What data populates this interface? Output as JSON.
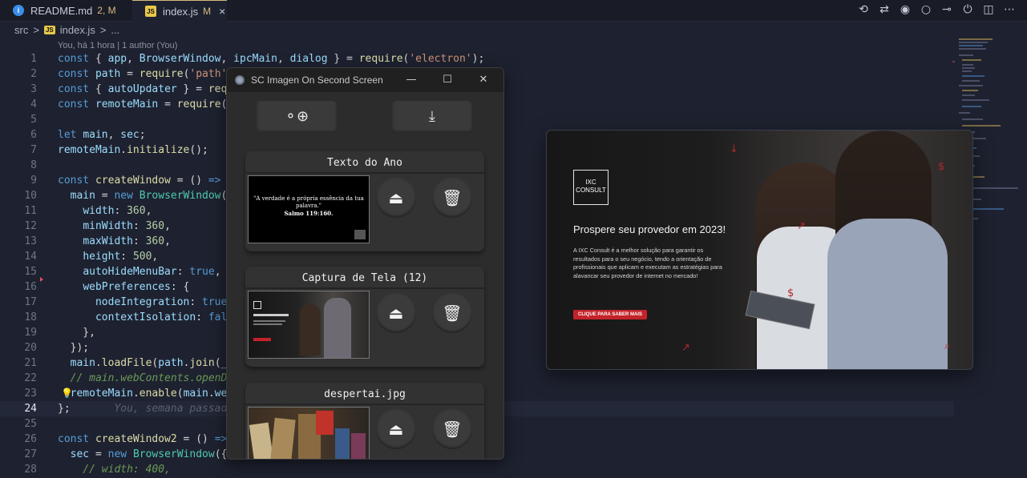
{
  "tabs": [
    {
      "icon": "info-icon",
      "label": "README.md",
      "status": "2, M"
    },
    {
      "icon": "js-icon",
      "label": "index.js",
      "status": "M",
      "close": "×"
    }
  ],
  "breadcrumb": {
    "folder": "src",
    "sep": ">",
    "js_badge": "JS",
    "file": "index.js",
    "sep2": ">",
    "rest": "..."
  },
  "blame": "You, há 1 hora | 1 author (You)",
  "code_lines": [
    {
      "n": "1"
    },
    {
      "n": "2"
    },
    {
      "n": "3"
    },
    {
      "n": "4"
    },
    {
      "n": "5"
    },
    {
      "n": "6"
    },
    {
      "n": "7"
    },
    {
      "n": "8"
    },
    {
      "n": "9"
    },
    {
      "n": "10"
    },
    {
      "n": "11"
    },
    {
      "n": "12"
    },
    {
      "n": "13"
    },
    {
      "n": "14"
    },
    {
      "n": "15"
    },
    {
      "n": "16"
    },
    {
      "n": "17"
    },
    {
      "n": "18"
    },
    {
      "n": "19"
    },
    {
      "n": "20"
    },
    {
      "n": "21"
    },
    {
      "n": "22"
    },
    {
      "n": "23"
    },
    {
      "n": "24"
    },
    {
      "n": "25"
    },
    {
      "n": "26"
    },
    {
      "n": "27"
    },
    {
      "n": "28"
    }
  ],
  "app_window": {
    "title": "SC Imagen On Second Screen",
    "controls": {
      "minimize": "—",
      "maximize": "☐",
      "close": "✕"
    },
    "toolbar": {
      "add_icon": "⚬⊕",
      "download_icon": "⤓"
    },
    "cards": [
      {
        "title": "Texto do Ano",
        "verse": "\"A verdade é a própria essência da tua palavra.\"",
        "verse_ref": "Salmo 119:160."
      },
      {
        "title": "Captura de Tela (12)"
      },
      {
        "title": "despertai.jpg"
      }
    ]
  },
  "promo": {
    "logo_line1": "IXC",
    "logo_line2": "CONSULT",
    "heading": "Prospere seu provedor em 2023!",
    "body": "A IXC Consult é a melhor solução para garantir os resultados para o seu negócio, tendo a orientação de profissionais que aplicam e executam as estratégias para alavancar seu provedor de internet no mercado!",
    "cta": "CLIQUE PARA SABER MAIS"
  },
  "colors": {
    "editor_bg": "#1e2230",
    "keyword": "#569cd6",
    "string": "#ce9178",
    "function": "#dcdcaa",
    "accent_red": "#c4222a"
  }
}
